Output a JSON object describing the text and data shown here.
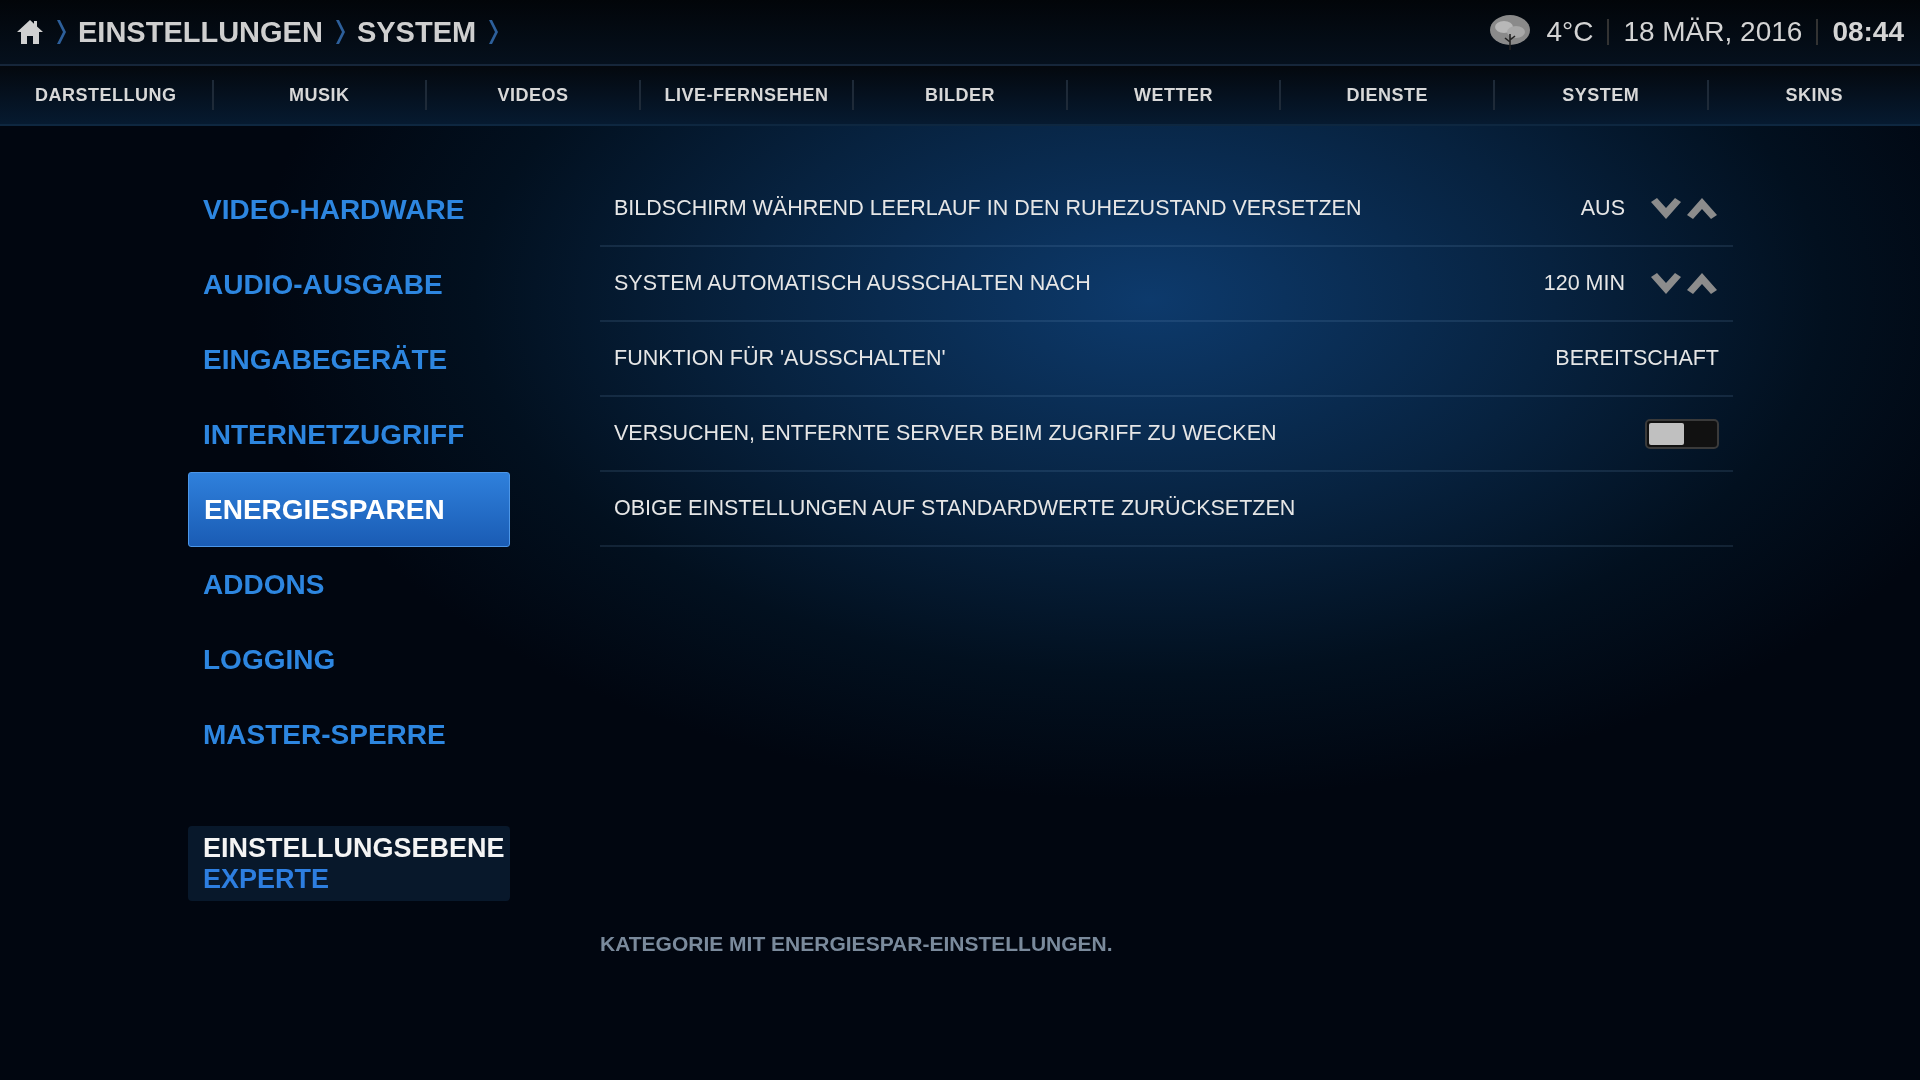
{
  "breadcrumb": [
    "EINSTELLUNGEN",
    "SYSTEM"
  ],
  "status": {
    "temperature": "4°C",
    "date": "18 MÄR, 2016",
    "time": "08:44"
  },
  "tabs": [
    {
      "label": "DARSTELLUNG",
      "selected": false
    },
    {
      "label": "MUSIK",
      "selected": false
    },
    {
      "label": "VIDEOS",
      "selected": false
    },
    {
      "label": "LIVE-FERNSEHEN",
      "selected": false
    },
    {
      "label": "BILDER",
      "selected": false
    },
    {
      "label": "WETTER",
      "selected": false
    },
    {
      "label": "DIENSTE",
      "selected": false
    },
    {
      "label": "SYSTEM",
      "selected": false
    },
    {
      "label": "SKINS",
      "selected": false
    }
  ],
  "sidebar": {
    "items": [
      {
        "label": "VIDEO-HARDWARE",
        "selected": false
      },
      {
        "label": "AUDIO-AUSGABE",
        "selected": false
      },
      {
        "label": "EINGABEGERÄTE",
        "selected": false
      },
      {
        "label": "INTERNETZUGRIFF",
        "selected": false
      },
      {
        "label": "ENERGIESPAREN",
        "selected": true
      },
      {
        "label": "ADDONS",
        "selected": false
      },
      {
        "label": "LOGGING",
        "selected": false
      },
      {
        "label": "MASTER-SPERRE",
        "selected": false
      }
    ],
    "level": {
      "label": "EINSTELLUNGSEBENE",
      "value": "EXPERTE"
    }
  },
  "settings": [
    {
      "kind": "spinner",
      "label": "BILDSCHIRM WÄHREND LEERLAUF IN DEN RUHEZUSTAND VERSETZEN",
      "value": "AUS"
    },
    {
      "kind": "spinner",
      "label": "SYSTEM AUTOMATISCH AUSSCHALTEN NACH",
      "value": "120 MIN"
    },
    {
      "kind": "value",
      "label": "FUNKTION FÜR 'AUSSCHALTEN'",
      "value": "BEREITSCHAFT"
    },
    {
      "kind": "toggle",
      "label": "VERSUCHEN, ENTFERNTE SERVER BEIM ZUGRIFF ZU WECKEN",
      "on": false
    },
    {
      "kind": "action",
      "label": "OBIGE EINSTELLUNGEN AUF STANDARDWERTE ZURÜCKSETZEN"
    }
  ],
  "description": "KATEGORIE MIT ENERGIESPAR-EINSTELLUNGEN."
}
